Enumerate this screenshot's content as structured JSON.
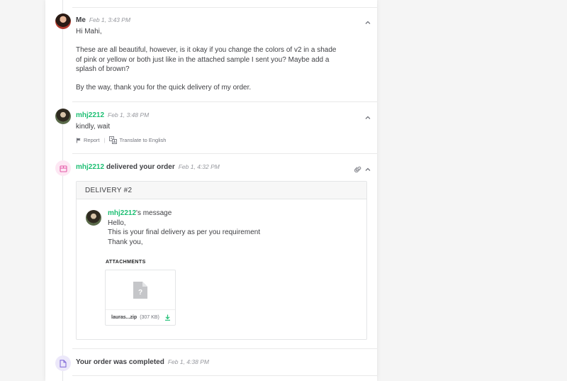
{
  "messages": [
    {
      "sender": "Me",
      "time": "Feb 1, 3:43 PM",
      "lines": [
        "Hi Mahi,",
        "",
        "These are all beautiful, however, is it okay if you change the colors of v2 in a shade",
        "of pink or yellow or both just like in the attached sample I sent you? Maybe add a",
        "splash of brown?",
        "",
        "By the way, thank you for the quick delivery of my order."
      ]
    },
    {
      "sender": "mhj2212",
      "time": "Feb 1, 3:48 PM",
      "text": "kindly, wait",
      "actions": {
        "report": "Report",
        "translate": "Translate to English"
      }
    }
  ],
  "delivery_event": {
    "user": "mhj2212",
    "text": "delivered your order",
    "time": "Feb 1, 4:32 PM",
    "box_title": "DELIVERY #2",
    "message_user": "mhj2212",
    "message_suffix": "'s message",
    "message_lines": [
      "Hello,",
      "This is your final delivery as per you requirement",
      "Thank you,"
    ],
    "attachments_title": "ATTACHMENTS",
    "attachment": {
      "name": "lauras...zip",
      "size": "(307 KB)"
    }
  },
  "completed_event": {
    "text": "Your order was completed",
    "time": "Feb 1, 4:38 PM"
  },
  "colors": {
    "accent_green": "#1dbf73",
    "pink_bg": "#fde7f3",
    "pink_icon": "#e45aa8",
    "lavender_bg": "#ece8fa",
    "lavender_icon": "#7b63d6"
  },
  "icons": [
    "chevron-up-icon",
    "flag-icon",
    "translate-icon",
    "paperclip-icon",
    "package-icon",
    "document-icon",
    "file-placeholder-icon",
    "download-icon"
  ]
}
